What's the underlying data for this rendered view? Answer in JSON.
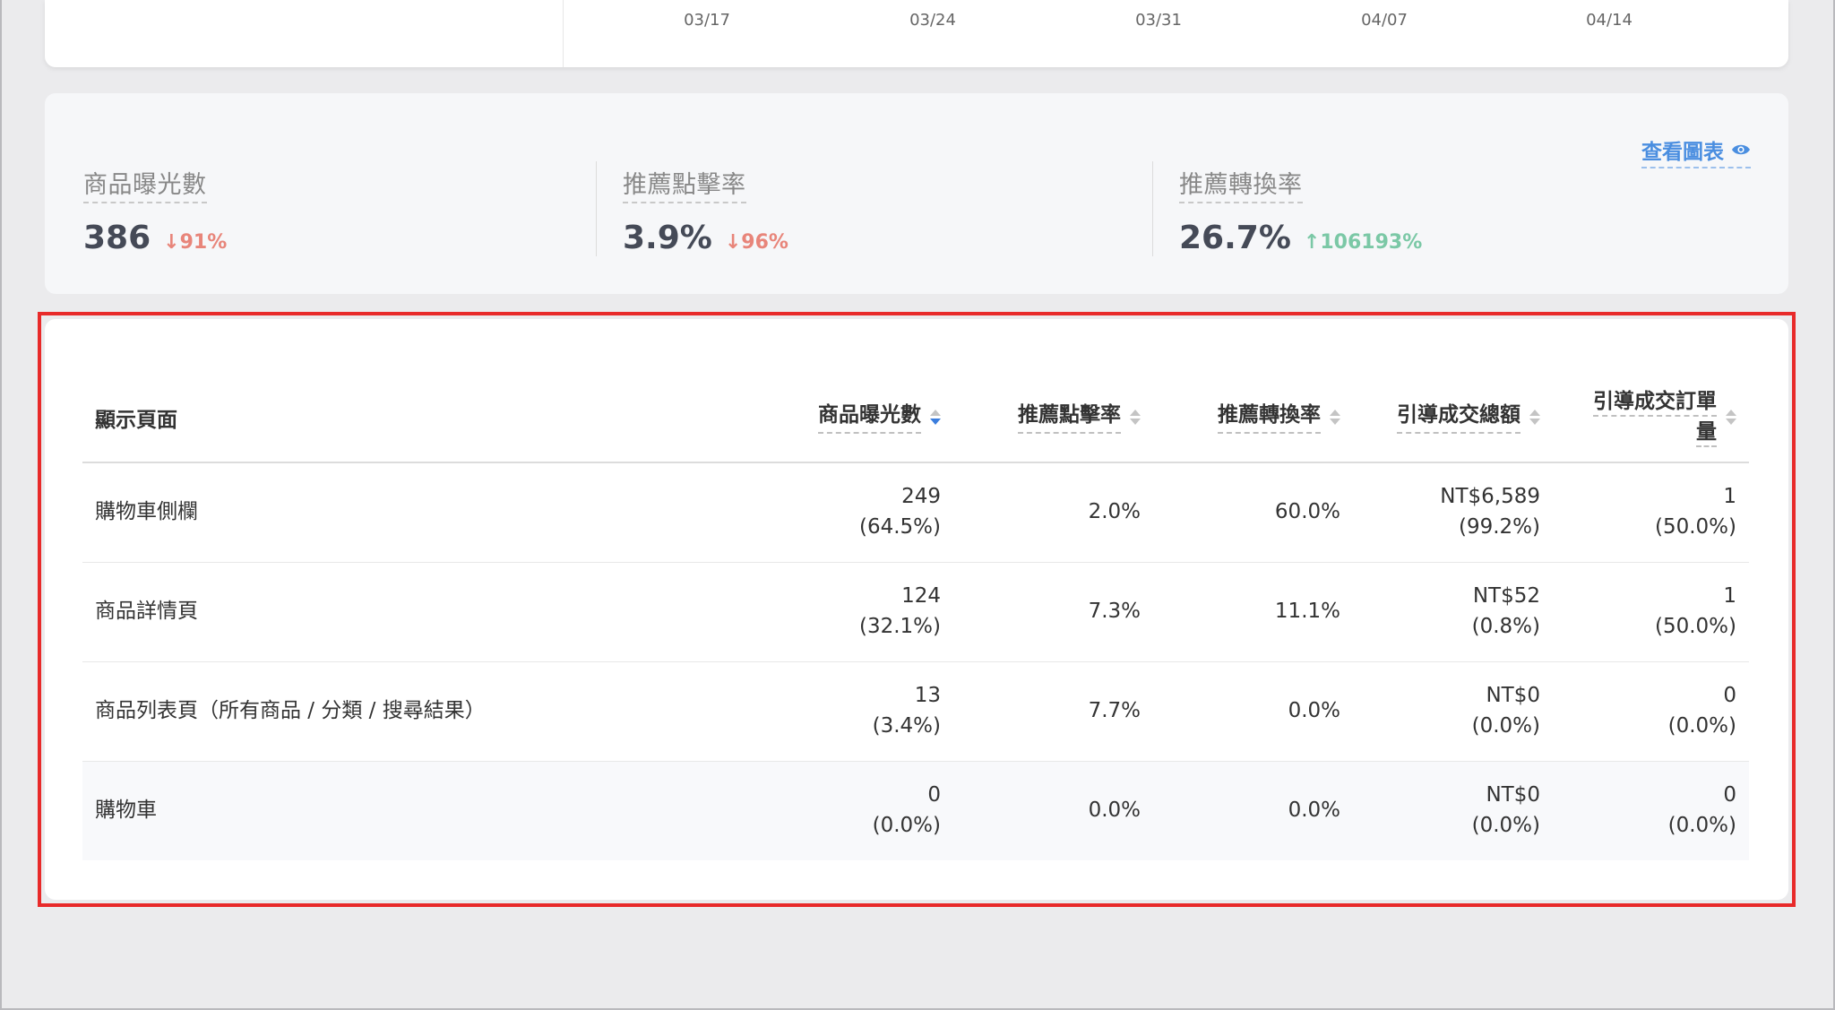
{
  "chart": {
    "x_ticks": [
      "03/17",
      "03/24",
      "03/31",
      "04/07",
      "04/14"
    ]
  },
  "metrics": [
    {
      "label": "商品曝光數",
      "value": "386",
      "change": "91%",
      "direction": "down"
    },
    {
      "label": "推薦點擊率",
      "value": "3.9%",
      "change": "96%",
      "direction": "down"
    },
    {
      "label": "推薦轉換率",
      "value": "26.7%",
      "change": "106193%",
      "direction": "up"
    }
  ],
  "view_chart_label": "查看圖表",
  "table": {
    "headers": {
      "page": "顯示頁面",
      "impressions": "商品曝光數",
      "ctr": "推薦點擊率",
      "cvr": "推薦轉換率",
      "gmv": "引導成交總額",
      "orders_line1": "引導成交訂單",
      "orders_line2": "量"
    },
    "rows": [
      {
        "page": "購物車側欄",
        "impressions": "249",
        "impressions_pct": "(64.5%)",
        "ctr": "2.0%",
        "cvr": "60.0%",
        "gmv": "NT$6,589",
        "gmv_pct": "(99.2%)",
        "orders": "1",
        "orders_pct": "(50.0%)"
      },
      {
        "page": "商品詳情頁",
        "impressions": "124",
        "impressions_pct": "(32.1%)",
        "ctr": "7.3%",
        "cvr": "11.1%",
        "gmv": "NT$52",
        "gmv_pct": "(0.8%)",
        "orders": "1",
        "orders_pct": "(50.0%)"
      },
      {
        "page": "商品列表頁（所有商品 / 分類 / 搜尋結果）",
        "impressions": "13",
        "impressions_pct": "(3.4%)",
        "ctr": "7.7%",
        "cvr": "0.0%",
        "gmv": "NT$0",
        "gmv_pct": "(0.0%)",
        "orders": "0",
        "orders_pct": "(0.0%)"
      },
      {
        "page": "購物車",
        "impressions": "0",
        "impressions_pct": "(0.0%)",
        "ctr": "0.0%",
        "cvr": "0.0%",
        "gmv": "NT$0",
        "gmv_pct": "(0.0%)",
        "orders": "0",
        "orders_pct": "(0.0%)"
      }
    ]
  },
  "colors": {
    "accent": "#4a8ee0",
    "down": "#e8857a",
    "up": "#7bc8a6",
    "highlight": "#e82a2a"
  }
}
